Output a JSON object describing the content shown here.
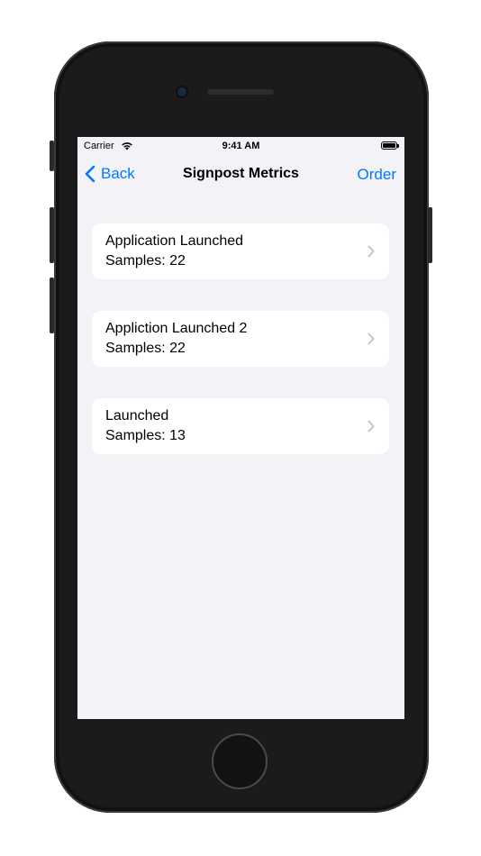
{
  "status_bar": {
    "carrier": "Carrier",
    "time": "9:41 AM",
    "wifi_icon": "wifi-icon",
    "battery_icon": "battery-icon"
  },
  "nav": {
    "back_label": "Back",
    "title": "Signpost Metrics",
    "order_label": "Order",
    "accent_color": "#007aff"
  },
  "metrics": [
    {
      "title": "Application Launched",
      "samples": "Samples: 22"
    },
    {
      "title": "Appliction Launched 2",
      "samples": "Samples: 22"
    },
    {
      "title": "Launched",
      "samples": "Samples: 13"
    }
  ],
  "colors": {
    "background": "#f2f2f7",
    "card": "#ffffff",
    "chevron": "#c4c4c7"
  }
}
